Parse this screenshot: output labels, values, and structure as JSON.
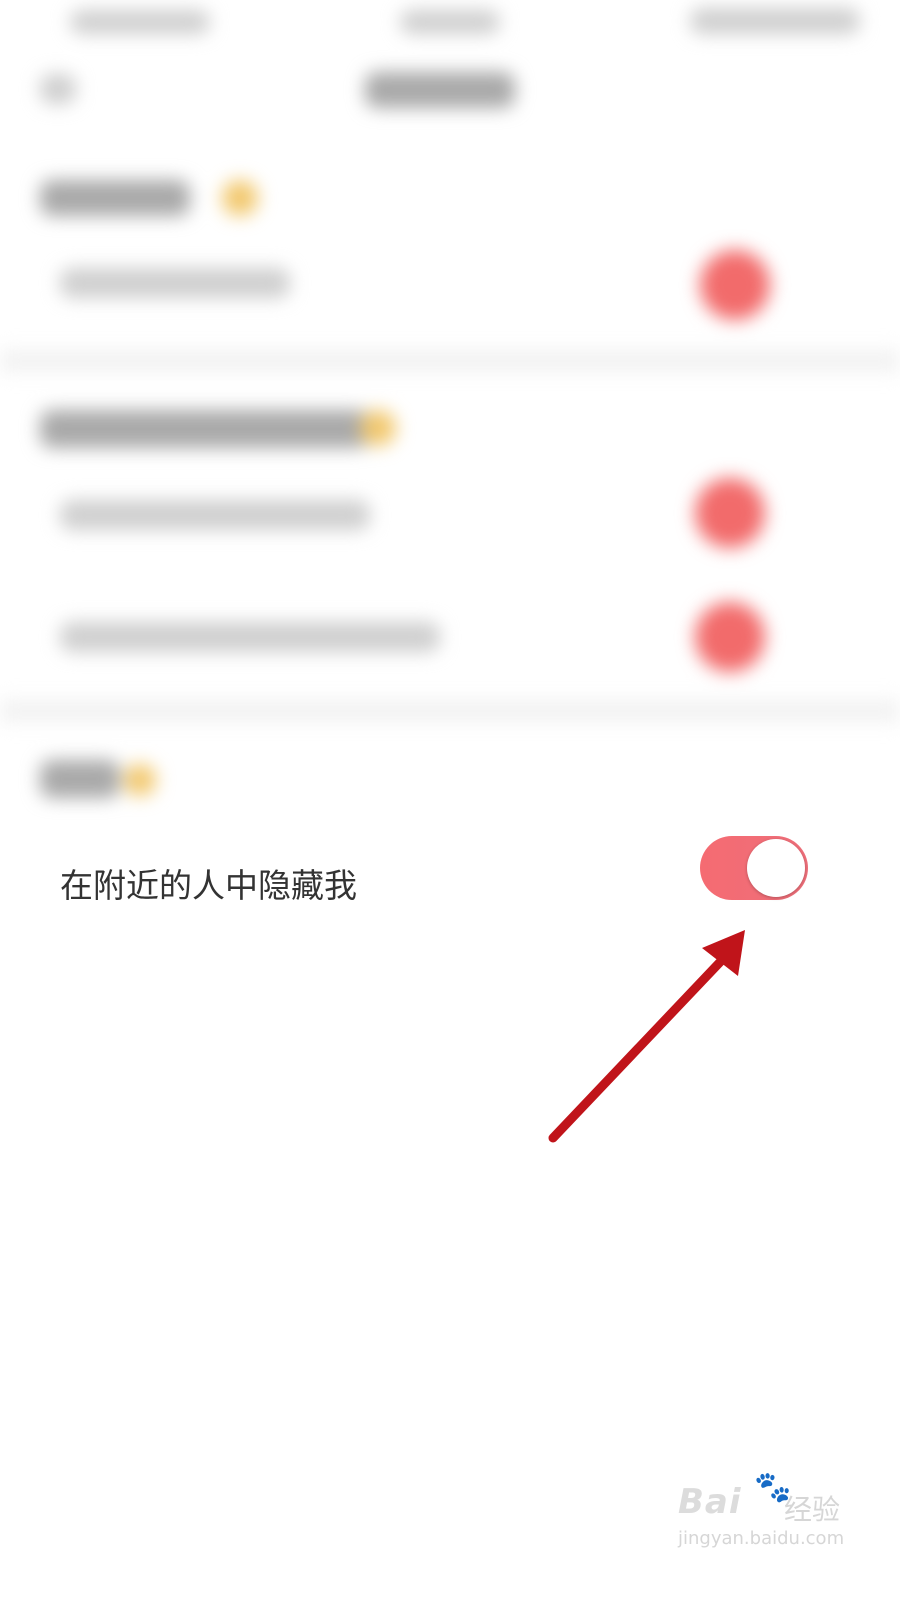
{
  "setting": {
    "label": "在附近的人中隐藏我",
    "toggle_on": true
  },
  "colors": {
    "toggle_on": "#f56b72",
    "label_text": "#333333",
    "annotation_arrow": "#c0141a"
  },
  "watermark": {
    "brand": "Bai",
    "brand_suffix": "经验",
    "url": "jingyan.baidu.com"
  }
}
